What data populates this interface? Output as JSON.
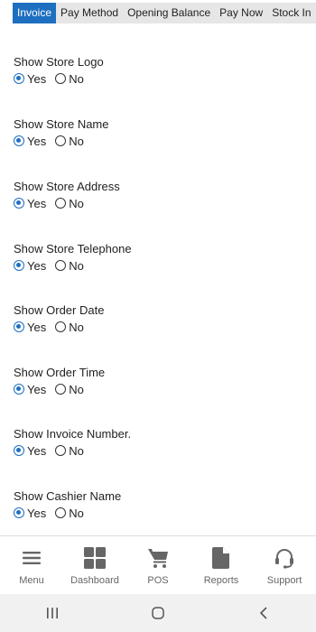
{
  "tabs": [
    "Invoice",
    "Pay Method",
    "Opening Balance",
    "Pay Now",
    "Stock In"
  ],
  "active_tab": "Invoice",
  "settings": [
    {
      "label": "Show Store Logo",
      "yes": "Yes",
      "no": "No",
      "selected": "Yes"
    },
    {
      "label": "Show Store Name",
      "yes": "Yes",
      "no": "No",
      "selected": "Yes"
    },
    {
      "label": "Show Store Address",
      "yes": "Yes",
      "no": "No",
      "selected": "Yes"
    },
    {
      "label": "Show Store Telephone",
      "yes": "Yes",
      "no": "No",
      "selected": "Yes"
    },
    {
      "label": "Show Order Date",
      "yes": "Yes",
      "no": "No",
      "selected": "Yes"
    },
    {
      "label": "Show Order Time",
      "yes": "Yes",
      "no": "No",
      "selected": "Yes"
    },
    {
      "label": "Show Invoice Number.",
      "yes": "Yes",
      "no": "No",
      "selected": "Yes"
    },
    {
      "label": "Show Cashier Name",
      "yes": "Yes",
      "no": "No",
      "selected": "Yes"
    }
  ],
  "bottom_nav": [
    {
      "label": "Menu",
      "icon": "menu-icon"
    },
    {
      "label": "Dashboard",
      "icon": "dashboard-icon"
    },
    {
      "label": "POS",
      "icon": "cart-icon"
    },
    {
      "label": "Reports",
      "icon": "document-icon"
    },
    {
      "label": "Support",
      "icon": "headset-icon"
    }
  ],
  "colors": {
    "accent": "#1e6fc0",
    "tab_bg": "#e6e6e6",
    "icon": "#666666",
    "system_bar": "#f1f1f1"
  }
}
